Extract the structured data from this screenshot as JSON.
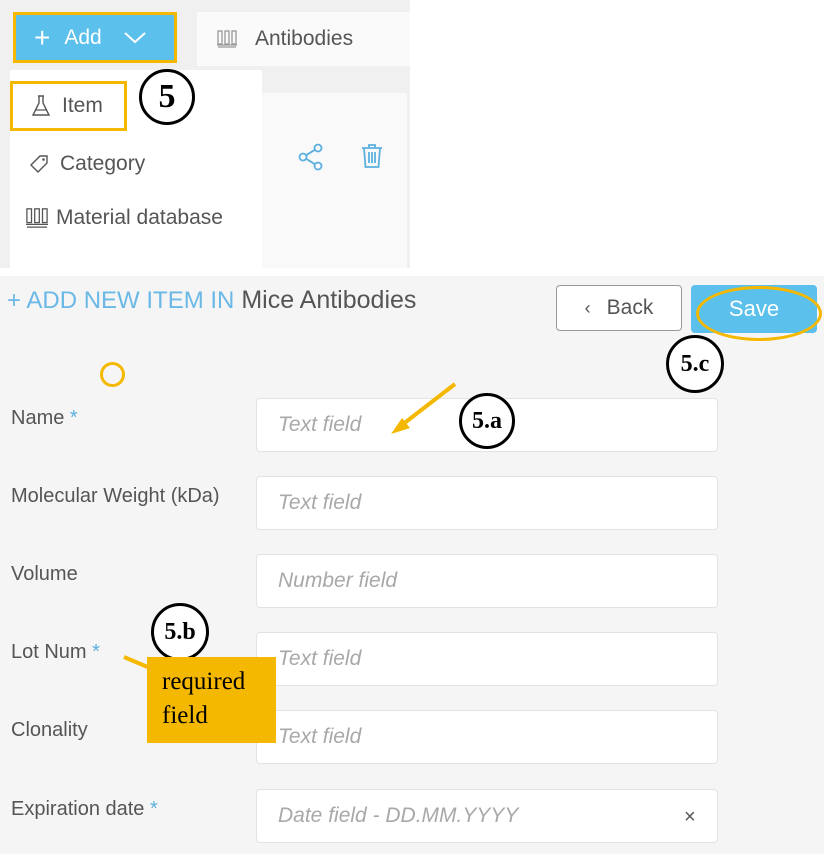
{
  "toolbar": {
    "add_label": "Add",
    "add_icon": "plus-icon",
    "dropdown_icon": "chevron-down-icon",
    "tab_label": "Antibodies",
    "tab_icon": "material-database-icon"
  },
  "add_menu": {
    "items": [
      {
        "label": "Item",
        "icon": "flask-icon"
      },
      {
        "label": "Category",
        "icon": "tag-icon"
      },
      {
        "label": "Material database",
        "icon": "material-database-icon"
      }
    ]
  },
  "card_actions": {
    "share_icon": "share-icon",
    "delete_icon": "trash-icon"
  },
  "annotations": {
    "step": "5",
    "step_a": "5.a",
    "step_b": "5.b",
    "step_c": "5.c",
    "callout": "required field",
    "highlight_color": "#f5b800"
  },
  "form": {
    "title_prefix": "+ ADD NEW ITEM IN",
    "list_name": "Mice Antibodies",
    "back_label": "Back",
    "save_label": "Save",
    "required_marker": "*",
    "fields": [
      {
        "label": "Name",
        "required": true,
        "placeholder": "Text field"
      },
      {
        "label": "Molecular Weight (kDa)",
        "required": false,
        "placeholder": "Text field"
      },
      {
        "label": "Volume",
        "required": false,
        "placeholder": "Number field"
      },
      {
        "label": "Lot Num",
        "required": true,
        "placeholder": "Text field"
      },
      {
        "label": "Clonality",
        "required": false,
        "placeholder": "Text field"
      },
      {
        "label": "Expiration date",
        "required": true,
        "placeholder": "Date field - DD.MM.YYYY",
        "clear": "×"
      }
    ]
  },
  "colors": {
    "accent": "#5bc0eb",
    "annotation": "#f5b800",
    "text": "#555555"
  }
}
